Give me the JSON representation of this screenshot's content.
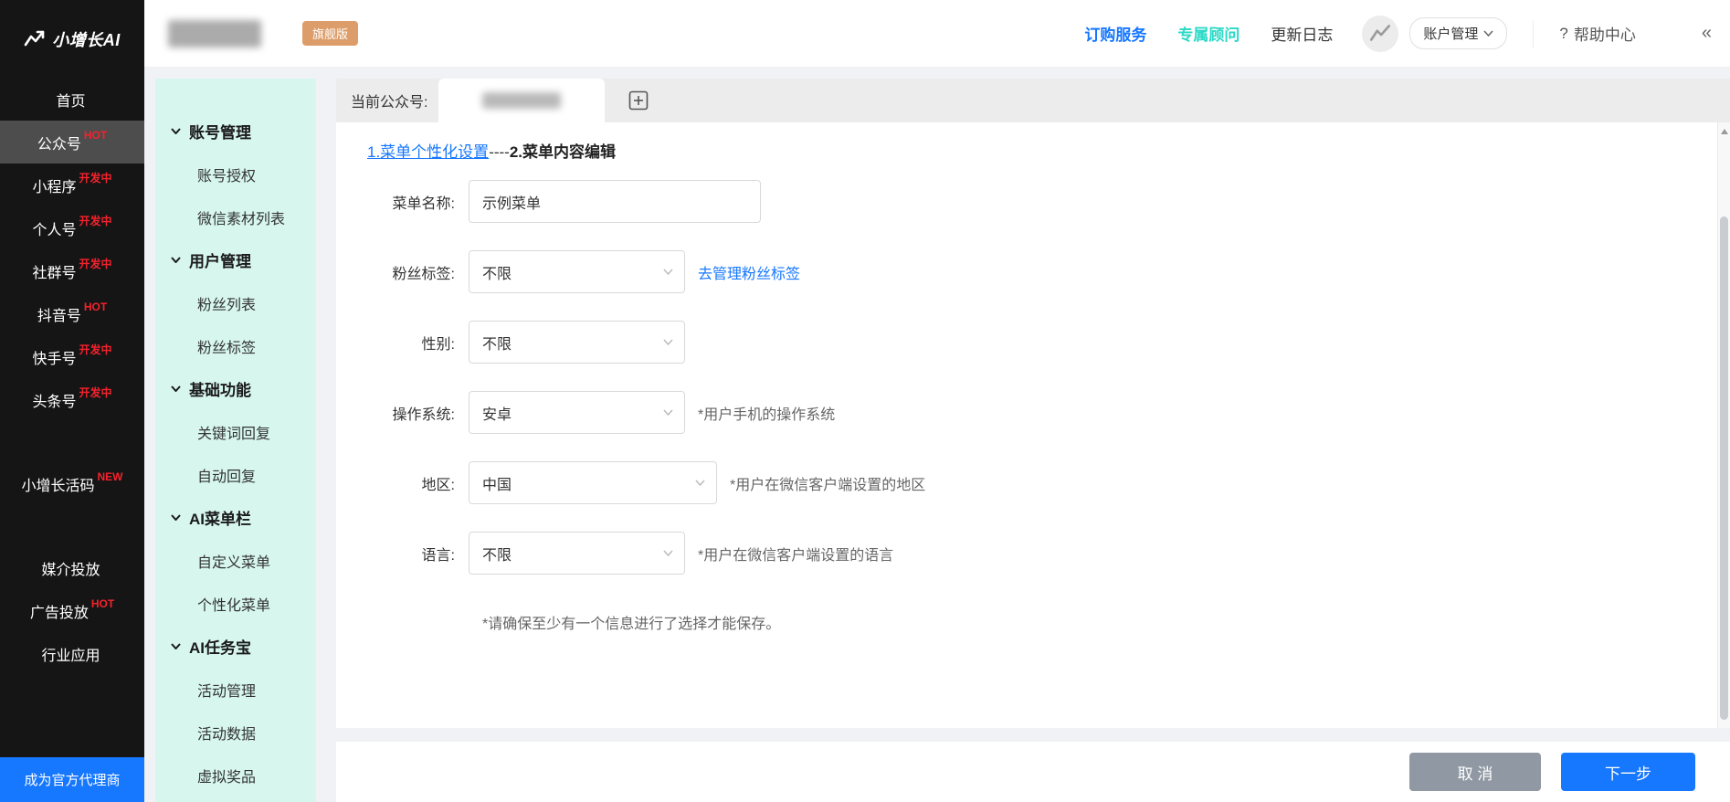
{
  "colors": {
    "accent_blue": "#1677ff",
    "accent_cyan": "#2bd9c7",
    "badge_red": "#f5222d",
    "submenu_bg": "#d7f7ee",
    "sidebar_bg": "#151515",
    "edition_badge_bg": "#dd9d6a"
  },
  "app": {
    "logo_text": "小增长AI",
    "edition_badge": "旗舰版"
  },
  "header": {
    "nav": [
      {
        "label": "订购服务"
      },
      {
        "label": "专属顾问"
      },
      {
        "label": "更新日志"
      }
    ],
    "account_menu": "账户管理",
    "account_menu_chevron": "∨",
    "help_icon": "?",
    "help": "帮助中心",
    "collapse": "«"
  },
  "sidebar": {
    "items": [
      {
        "label": "首页",
        "badge": ""
      },
      {
        "label": "公众号",
        "badge": "HOT"
      },
      {
        "label": "小程序",
        "badge": "开发中"
      },
      {
        "label": "个人号",
        "badge": "开发中"
      },
      {
        "label": "社群号",
        "badge": "开发中"
      },
      {
        "label": "抖音号",
        "badge": "HOT"
      },
      {
        "label": "快手号",
        "badge": "开发中"
      },
      {
        "label": "头条号",
        "badge": "开发中"
      },
      {
        "label": "小增长活码",
        "badge": "NEW"
      },
      {
        "label": "媒介投放",
        "badge": ""
      },
      {
        "label": "广告投放",
        "badge": "HOT"
      },
      {
        "label": "行业应用",
        "badge": ""
      }
    ],
    "agent_button": "成为官方代理商"
  },
  "submenu": {
    "groups": [
      {
        "label": "账号管理",
        "items": [
          "账号授权",
          "微信素材列表"
        ]
      },
      {
        "label": "用户管理",
        "items": [
          "粉丝列表",
          "粉丝标签"
        ]
      },
      {
        "label": "基础功能",
        "items": [
          "关键词回复",
          "自动回复"
        ]
      },
      {
        "label": "AI菜单栏",
        "items": [
          "自定义菜单",
          "个性化菜单"
        ]
      },
      {
        "label": "AI任务宝",
        "items": [
          "活动管理",
          "活动数据",
          "虚拟奖品"
        ]
      }
    ]
  },
  "main": {
    "current_account_label": "当前公众号:",
    "steps": {
      "step1": "1.菜单个性化设置",
      "separator": "----",
      "step2": "2.菜单内容编辑"
    },
    "form": {
      "menu_name": {
        "label": "菜单名称:",
        "value": "示例菜单"
      },
      "fan_tag": {
        "label": "粉丝标签:",
        "value": "不限",
        "link": "去管理粉丝标签"
      },
      "gender": {
        "label": "性别:",
        "value": "不限"
      },
      "os": {
        "label": "操作系统:",
        "value": "安卓",
        "note": "*用户手机的操作系统"
      },
      "region": {
        "label": "地区:",
        "value": "中国",
        "note": "*用户在微信客户端设置的地区"
      },
      "language": {
        "label": "语言:",
        "value": "不限",
        "note": "*用户在微信客户端设置的语言"
      },
      "save_note": "*请确保至少有一个信息进行了选择才能保存。"
    },
    "actions": {
      "cancel": "取 消",
      "next": "下一步"
    }
  }
}
